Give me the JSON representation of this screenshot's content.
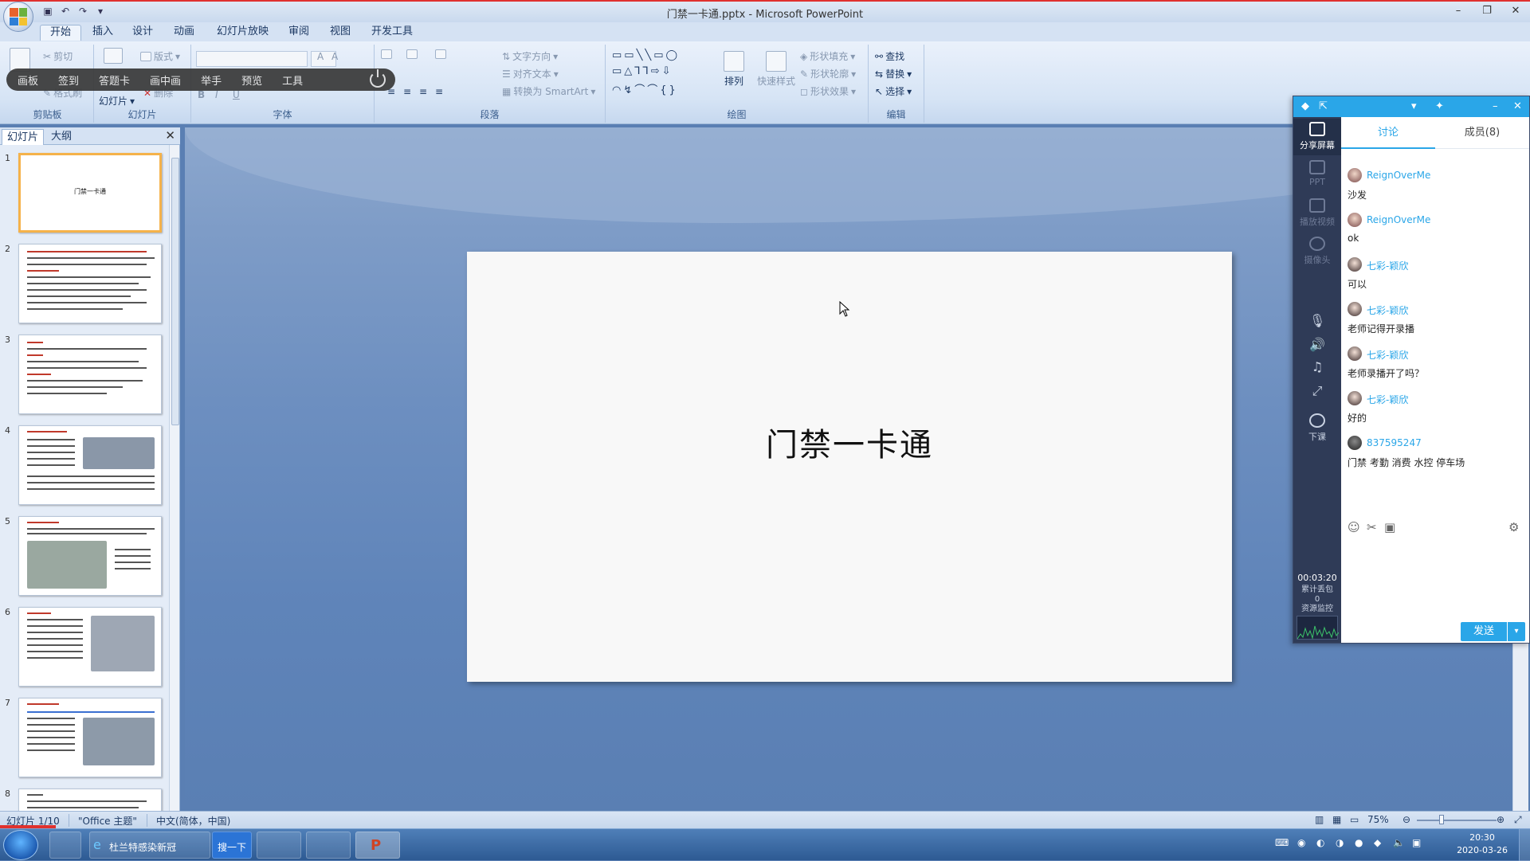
{
  "window": {
    "title": "门禁一卡通.pptx - Microsoft PowerPoint",
    "controls": [
      "–",
      "❐",
      "✕"
    ]
  },
  "ribbon": {
    "tabs": [
      "开始",
      "插入",
      "设计",
      "动画",
      "幻灯片放映",
      "审阅",
      "视图",
      "开发工具"
    ],
    "active_tab": "开始",
    "groups": {
      "clipboard": {
        "name": "剪贴板",
        "cut": "剪切",
        "format_painter": "格式刷"
      },
      "slides": {
        "name": "幻灯片",
        "layout": "版式",
        "slide": "幻灯片",
        "delete": "删除"
      },
      "font": {
        "name": "字体"
      },
      "paragraph": {
        "name": "段落",
        "text_direction": "文字方向",
        "align_text": "对齐文本",
        "smartart": "转换为 SmartArt"
      },
      "drawing": {
        "name": "绘图",
        "arrange": "排列",
        "quick_styles": "快速样式",
        "shape_fill": "形状填充",
        "shape_outline": "形状轮廓",
        "shape_effects": "形状效果"
      },
      "editing": {
        "name": "编辑",
        "find": "查找",
        "replace": "替换",
        "select": "选择"
      }
    }
  },
  "float_toolbar": {
    "items": [
      "画板",
      "签到",
      "答题卡",
      "画中画",
      "举手",
      "预览",
      "工具"
    ]
  },
  "slides_panel": {
    "tabs": [
      "幻灯片",
      "大纲"
    ],
    "active_tab": "幻灯片",
    "close": "✕",
    "thumbnails": [
      {
        "num": "1",
        "title": "门禁一卡通",
        "selected": true
      },
      {
        "num": "2"
      },
      {
        "num": "3"
      },
      {
        "num": "4"
      },
      {
        "num": "5"
      },
      {
        "num": "6"
      },
      {
        "num": "7"
      },
      {
        "num": "8"
      }
    ]
  },
  "slide": {
    "title": "门禁一卡通"
  },
  "chat": {
    "side": {
      "share_screen": "分享屏幕",
      "ppt": "PPT",
      "play_video": "播放视频",
      "camera": "摄像头",
      "end_class": "下课",
      "timer": "00:03:20",
      "stats_line1": "累计丢包",
      "stats_line2": "0",
      "stats_line3": "资源监控"
    },
    "tabs": [
      "讨论",
      "成员(8)"
    ],
    "active_tab": "讨论",
    "messages": [
      {
        "user": "ReignOverMe",
        "text": "沙发"
      },
      {
        "user": "ReignOverMe",
        "text": "ok"
      },
      {
        "user": "七彩-颖欣",
        "text": "可以"
      },
      {
        "user": "七彩-颖欣",
        "text": "老师记得开录播"
      },
      {
        "user": "七彩-颖欣",
        "text": "老师录播开了吗？"
      },
      {
        "user": "七彩-颖欣",
        "text": "好的"
      },
      {
        "user": "837595247",
        "text": "门禁 考勤 消费 水控 停车场"
      }
    ],
    "send": "发送"
  },
  "status": {
    "slide_info": "幻灯片 1/10",
    "theme": "\"Office 主题\"",
    "language": "中文(简体，中国)",
    "zoom": "75%"
  },
  "taskbar": {
    "ie_title": "杜兰特感染新冠",
    "search": "搜一下",
    "clock_time": "20:30",
    "clock_date": "2020-03-26"
  },
  "colors": {
    "accent": "#2aa6e8",
    "chat_sidebar": "#2f3b57",
    "selected_thumb": "#f5b24a",
    "title_red": "#e0312e"
  }
}
